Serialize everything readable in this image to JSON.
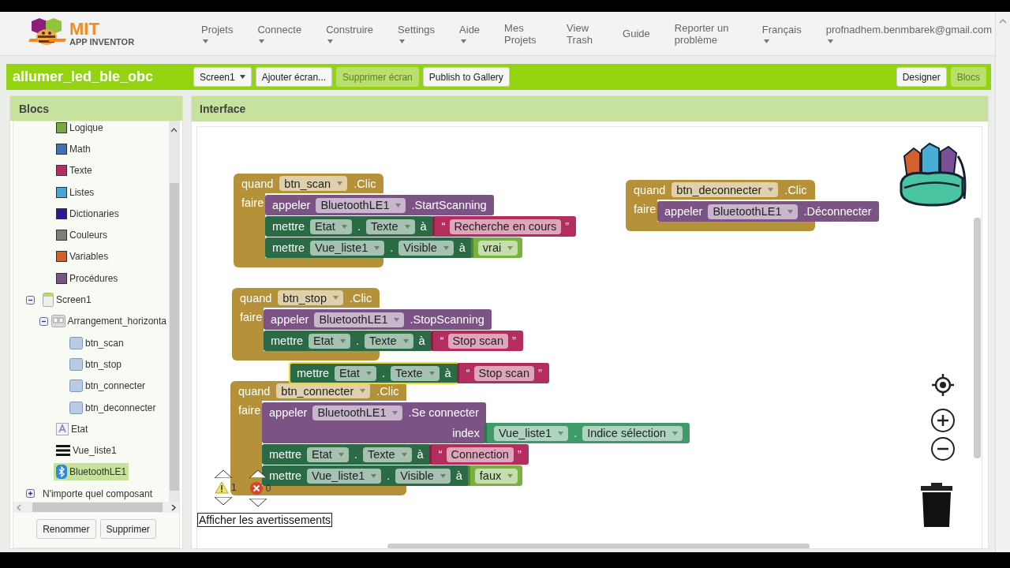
{
  "header": {
    "logo": {
      "title": "MIT",
      "subtitle": "APP INVENTOR"
    },
    "menu": [
      {
        "label": "Projets",
        "has_menu": true
      },
      {
        "label": "Connecte",
        "has_menu": true
      },
      {
        "label": "Construire",
        "has_menu": true
      },
      {
        "label": "Settings",
        "has_menu": true
      },
      {
        "label": "Aide",
        "has_menu": true
      },
      {
        "label": "Mes Projets",
        "has_menu": false
      },
      {
        "label": "View Trash",
        "has_menu": false
      },
      {
        "label": "Guide",
        "has_menu": false
      },
      {
        "label": "Reporter un problème",
        "has_menu": false
      },
      {
        "label": "Français",
        "has_menu": true
      },
      {
        "label": "profnadhem.benmbarek@gmail.com",
        "has_menu": true
      }
    ]
  },
  "toolbar": {
    "project": "allumer_led_ble_obc",
    "buttons": [
      {
        "label": "Screen1",
        "kind": "dropdown",
        "disabled": false
      },
      {
        "label": "Ajouter écran...",
        "kind": "button",
        "disabled": false
      },
      {
        "label": "Supprimer écran",
        "kind": "button",
        "disabled": true
      },
      {
        "label": "Publish to Gallery",
        "kind": "button",
        "disabled": false
      }
    ],
    "views": [
      {
        "label": "Designer",
        "selected": false
      },
      {
        "label": "Blocs",
        "selected": true
      }
    ]
  },
  "sidebar": {
    "title": "Blocs",
    "builtins": [
      {
        "label": "Logique",
        "color": "#77ab41",
        "selected": false
      },
      {
        "label": "Math",
        "color": "#3f71b5",
        "selected": false
      },
      {
        "label": "Texte",
        "color": "#b32d5e",
        "selected": false
      },
      {
        "label": "Listes",
        "color": "#49a6d4",
        "selected": false
      },
      {
        "label": "Dictionaries",
        "color": "#2d1799",
        "selected": false
      },
      {
        "label": "Couleurs",
        "color": "#7d7d7d",
        "selected": false
      },
      {
        "label": "Variables",
        "color": "#d05f2d",
        "selected": false
      },
      {
        "label": "Procédures",
        "color": "#7c5385",
        "selected": false
      }
    ],
    "tree": [
      {
        "label": "Screen1",
        "kind": "screen",
        "expanded": true,
        "selected": false,
        "children": [
          {
            "label": "Arrangement_horizonta",
            "kind": "arrangement",
            "expanded": true,
            "selected": false,
            "children": [
              {
                "label": "btn_scan",
                "kind": "button",
                "selected": false
              },
              {
                "label": "btn_stop",
                "kind": "button",
                "selected": false
              },
              {
                "label": "btn_connecter",
                "kind": "button",
                "selected": false
              },
              {
                "label": "btn_deconnecter",
                "kind": "button",
                "selected": false
              }
            ]
          },
          {
            "label": "Etat",
            "kind": "label",
            "selected": false
          },
          {
            "label": "Vue_liste1",
            "kind": "listview",
            "selected": false
          },
          {
            "label": "BluetoothLE1",
            "kind": "bluetooth",
            "selected": true
          }
        ]
      },
      {
        "label": "N'importe quel composant",
        "kind": "any",
        "expanded": false,
        "selected": false
      }
    ],
    "buttons": [
      "Renommer",
      "Supprimer"
    ]
  },
  "workspace": {
    "title": "Interface",
    "events": [
      {
        "keyword": "quand",
        "component": "btn_scan",
        "event": ".Clic",
        "do_keyword": "faire",
        "statements": [
          {
            "kind": "call",
            "keyword": "appeler",
            "component": "BluetoothLE1",
            "method": ".StartScanning"
          },
          {
            "kind": "set",
            "keyword": "mettre",
            "component": "Etat",
            "dot": ".",
            "property": "Texte",
            "to": "à",
            "value": {
              "kind": "text",
              "open_quote": "“",
              "text": "Recherche en cours",
              "close_quote": "”"
            }
          },
          {
            "kind": "set",
            "keyword": "mettre",
            "component": "Vue_liste1",
            "dot": ".",
            "property": "Visible",
            "to": "à",
            "value": {
              "kind": "logic",
              "value": "vrai"
            }
          }
        ]
      },
      {
        "keyword": "quand",
        "component": "btn_stop",
        "event": ".Clic",
        "do_keyword": "faire",
        "statements": [
          {
            "kind": "call",
            "keyword": "appeler",
            "component": "BluetoothLE1",
            "method": ".StopScanning"
          },
          {
            "kind": "set",
            "keyword": "mettre",
            "component": "Etat",
            "dot": ".",
            "property": "Texte",
            "to": "à",
            "value": {
              "kind": "text",
              "open_quote": "“",
              "text": "Stop scan",
              "close_quote": "”"
            }
          }
        ]
      },
      {
        "keyword": "quand",
        "component": "btn_connecter",
        "event": ".Clic",
        "do_keyword": "faire",
        "statements": [
          {
            "kind": "call",
            "keyword": "appeler",
            "component": "BluetoothLE1",
            "method": ".Se connecter",
            "argument": {
              "name": "index",
              "value": {
                "kind": "getter",
                "component": "Vue_liste1",
                "dot": ".",
                "property": "Indice sélection"
              }
            }
          },
          {
            "kind": "set",
            "keyword": "mettre",
            "component": "Etat",
            "dot": ".",
            "property": "Texte",
            "to": "à",
            "value": {
              "kind": "text",
              "open_quote": "“",
              "text": "Connection",
              "close_quote": "”"
            }
          },
          {
            "kind": "set",
            "keyword": "mettre",
            "component": "Vue_liste1",
            "dot": ".",
            "property": "Visible",
            "to": "à",
            "value": {
              "kind": "logic",
              "value": "faux"
            }
          }
        ]
      },
      {
        "keyword": "quand",
        "component": "btn_deconnecter",
        "event": ".Clic",
        "do_keyword": "faire",
        "statements": [
          {
            "kind": "call",
            "keyword": "appeler",
            "component": "BluetoothLE1",
            "method": ".Déconnecter"
          }
        ]
      }
    ],
    "loose_block": {
      "kind": "set",
      "keyword": "mettre",
      "component": "Etat",
      "dot": ".",
      "property": "Texte",
      "to": "à",
      "selected": true,
      "value": {
        "kind": "text",
        "open_quote": "“",
        "text": "Stop scan",
        "close_quote": "”"
      }
    },
    "warnings": {
      "warning_count": "1",
      "error_count": "0",
      "toggle_label": "Afficher les avertissements"
    }
  }
}
